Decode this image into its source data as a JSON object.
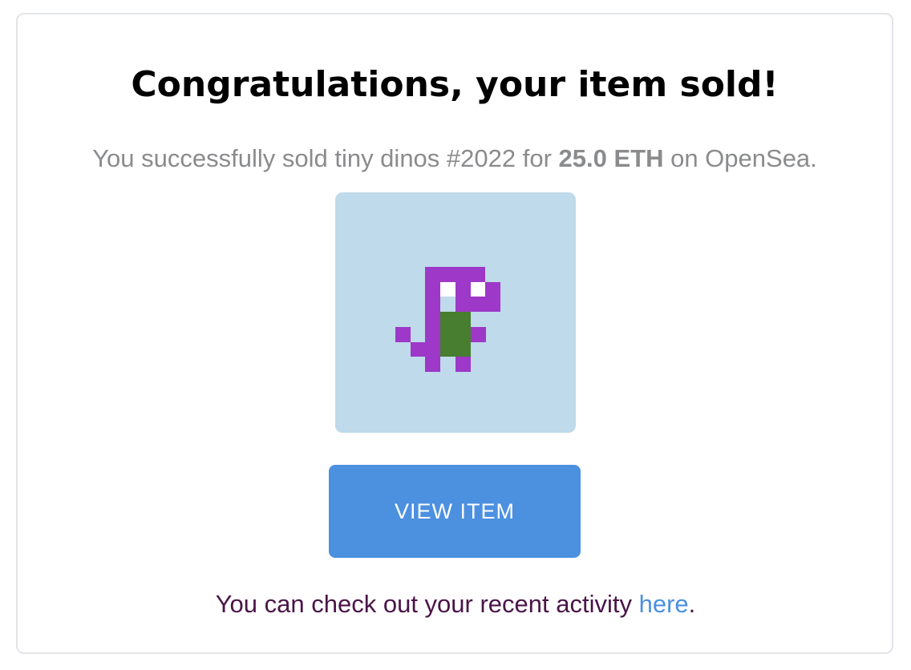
{
  "heading": "Congratulations, your item sold!",
  "message": {
    "prefix": "You successfully sold tiny dinos #2022 for ",
    "price": "25.0 ETH",
    "suffix": " on OpenSea."
  },
  "item": {
    "image_icon": "pixel-dino-icon",
    "background_color": "#bfdaea",
    "body_color": "#9d38c8",
    "belly_color": "#477e2f",
    "eye_color": "#ffffff"
  },
  "view_button_label": "VIEW ITEM",
  "footer": {
    "prefix": "You can check out your recent activity ",
    "link_text": "here",
    "suffix": "."
  },
  "colors": {
    "button": "#4c90e0",
    "link": "#4c90e0",
    "footer_text": "#4a1548",
    "muted_text": "#8a8b8d"
  }
}
